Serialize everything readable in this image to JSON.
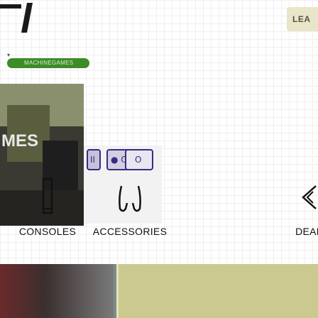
{
  "header": {
    "button_label": "LEA"
  },
  "source_badge": {
    "text": "MACHINEGAMES"
  },
  "thumbnail": {
    "overlay_text": "MES",
    "mini_buttons": [
      "II",
      "● O",
      "O"
    ]
  },
  "categories": [
    {
      "label": "CONSOLES",
      "icon": "console-icon"
    },
    {
      "label": "ACCESSORIES",
      "icon": "controller-icon"
    },
    {
      "label": "DEAL",
      "icon": "deals-icon"
    }
  ],
  "colors": {
    "badge": "#3c8c27",
    "header_button": "#e9e5c9",
    "bottom_banner_right": "#cbc98f"
  }
}
